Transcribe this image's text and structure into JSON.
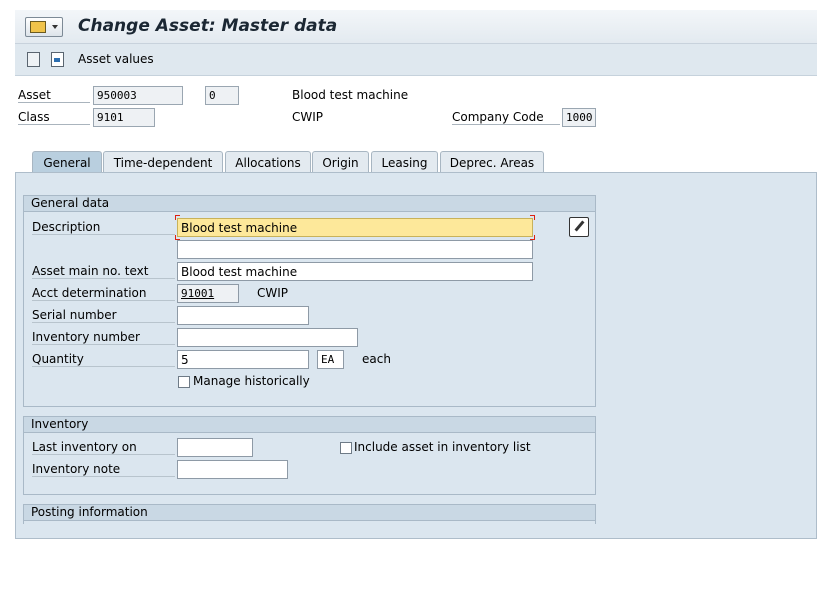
{
  "window": {
    "title": "Change Asset:  Master data"
  },
  "toolbar": {
    "asset_values_label": "Asset values"
  },
  "header": {
    "asset_label": "Asset",
    "asset_value": "950003",
    "sub_number": "0",
    "asset_desc": "Blood test machine",
    "class_label": "Class",
    "class_value": "9101",
    "class_desc": "CWIP",
    "company_code_label": "Company Code",
    "company_code_value": "1000"
  },
  "tabs": [
    "General",
    "Time-dependent",
    "Allocations",
    "Origin",
    "Leasing",
    "Deprec. Areas"
  ],
  "general_data": {
    "title": "General data",
    "description_label": "Description",
    "description_value": "Blood test machine",
    "description_value2": "",
    "main_text_label": "Asset main no. text",
    "main_text_value": "Blood test machine",
    "acct_det_label": "Acct determination",
    "acct_det_value": "91001",
    "acct_det_desc": "CWIP",
    "serial_label": "Serial number",
    "serial_value": "",
    "inventory_number_label": "Inventory number",
    "inventory_number_value": "",
    "quantity_label": "Quantity",
    "quantity_value": "5",
    "unit_value": "EA",
    "unit_desc": "each",
    "manage_hist_label": "Manage historically"
  },
  "inventory": {
    "title": "Inventory",
    "last_inv_label": "Last inventory on",
    "last_inv_value": "",
    "include_label": "Include asset in inventory list",
    "note_label": "Inventory note",
    "note_value": ""
  },
  "posting": {
    "title": "Posting information"
  }
}
